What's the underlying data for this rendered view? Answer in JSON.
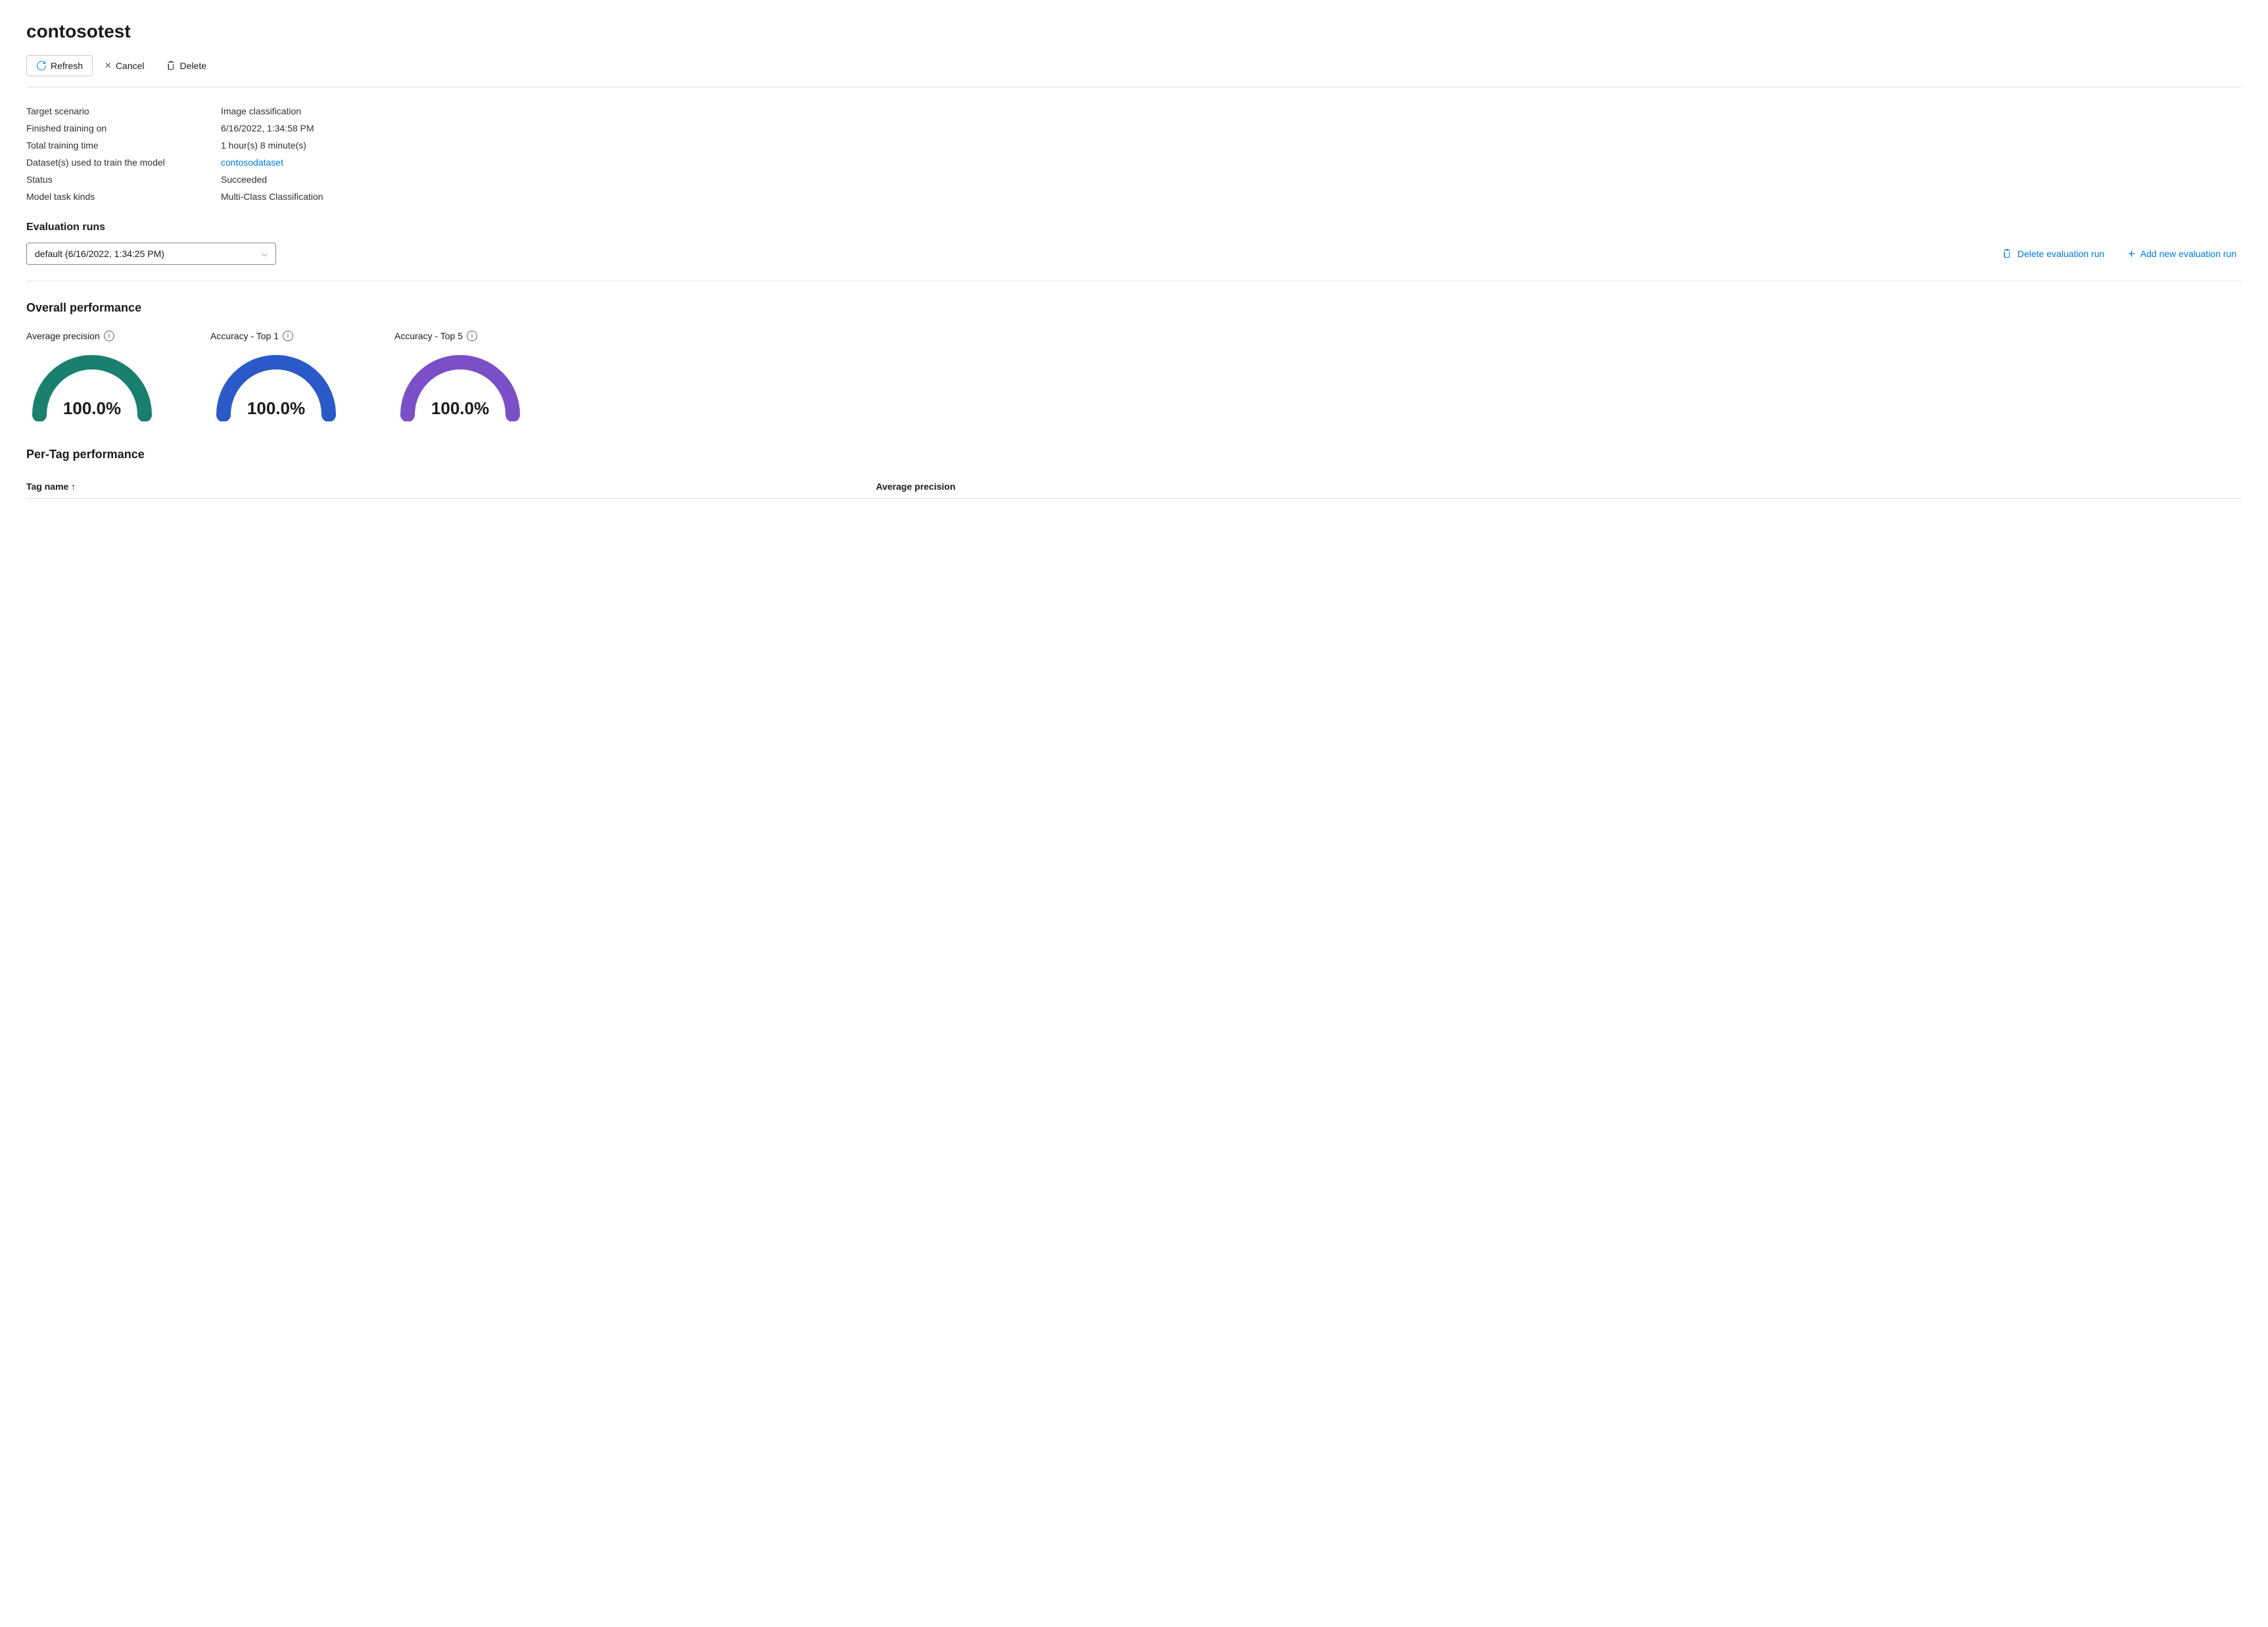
{
  "page": {
    "title": "contosotest"
  },
  "toolbar": {
    "refresh_label": "Refresh",
    "cancel_label": "Cancel",
    "delete_label": "Delete"
  },
  "info": {
    "fields": [
      {
        "label": "Target scenario",
        "value": "Image classification",
        "isLink": false
      },
      {
        "label": "Finished training on",
        "value": "6/16/2022, 1:34:58 PM",
        "isLink": false
      },
      {
        "label": "Total training time",
        "value": "1 hour(s) 8 minute(s)",
        "isLink": false
      },
      {
        "label": "Dataset(s) used to train the model",
        "value": "contosodataset",
        "isLink": true
      },
      {
        "label": "Status",
        "value": "Succeeded",
        "isLink": false
      },
      {
        "label": "Model task kinds",
        "value": "Multi-Class Classification",
        "isLink": false
      }
    ]
  },
  "evaluation_runs": {
    "section_title": "Evaluation runs",
    "dropdown_value": "default (6/16/2022, 1:34:25 PM)",
    "delete_action": "Delete evaluation run",
    "add_action": "Add new evaluation run"
  },
  "overall_performance": {
    "section_title": "Overall performance",
    "metrics": [
      {
        "label": "Average precision",
        "value": "100.0%",
        "color": "#1B7F6E",
        "id": "gauge-avg-precision"
      },
      {
        "label": "Accuracy - Top 1",
        "value": "100.0%",
        "color": "#2B5AC8",
        "id": "gauge-acc-top1"
      },
      {
        "label": "Accuracy - Top 5",
        "value": "100.0%",
        "color": "#7B4FC8",
        "id": "gauge-acc-top5"
      }
    ]
  },
  "per_tag_performance": {
    "section_title": "Per-Tag performance",
    "columns": [
      {
        "label": "Tag name",
        "sortable": true,
        "sort_direction": "asc"
      },
      {
        "label": "Average precision",
        "sortable": false
      }
    ]
  }
}
